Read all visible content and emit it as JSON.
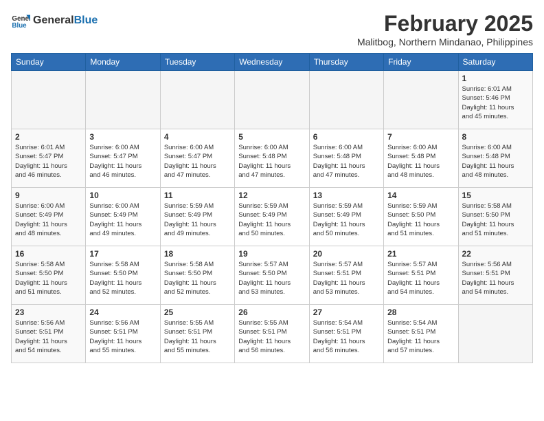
{
  "header": {
    "logo_general": "General",
    "logo_blue": "Blue",
    "month_year": "February 2025",
    "location": "Malitbog, Northern Mindanao, Philippines"
  },
  "days_of_week": [
    "Sunday",
    "Monday",
    "Tuesday",
    "Wednesday",
    "Thursday",
    "Friday",
    "Saturday"
  ],
  "weeks": [
    [
      {
        "day": "",
        "info": ""
      },
      {
        "day": "",
        "info": ""
      },
      {
        "day": "",
        "info": ""
      },
      {
        "day": "",
        "info": ""
      },
      {
        "day": "",
        "info": ""
      },
      {
        "day": "",
        "info": ""
      },
      {
        "day": "1",
        "info": "Sunrise: 6:01 AM\nSunset: 5:46 PM\nDaylight: 11 hours\nand 45 minutes."
      }
    ],
    [
      {
        "day": "2",
        "info": "Sunrise: 6:01 AM\nSunset: 5:47 PM\nDaylight: 11 hours\nand 46 minutes."
      },
      {
        "day": "3",
        "info": "Sunrise: 6:00 AM\nSunset: 5:47 PM\nDaylight: 11 hours\nand 46 minutes."
      },
      {
        "day": "4",
        "info": "Sunrise: 6:00 AM\nSunset: 5:47 PM\nDaylight: 11 hours\nand 47 minutes."
      },
      {
        "day": "5",
        "info": "Sunrise: 6:00 AM\nSunset: 5:48 PM\nDaylight: 11 hours\nand 47 minutes."
      },
      {
        "day": "6",
        "info": "Sunrise: 6:00 AM\nSunset: 5:48 PM\nDaylight: 11 hours\nand 47 minutes."
      },
      {
        "day": "7",
        "info": "Sunrise: 6:00 AM\nSunset: 5:48 PM\nDaylight: 11 hours\nand 48 minutes."
      },
      {
        "day": "8",
        "info": "Sunrise: 6:00 AM\nSunset: 5:48 PM\nDaylight: 11 hours\nand 48 minutes."
      }
    ],
    [
      {
        "day": "9",
        "info": "Sunrise: 6:00 AM\nSunset: 5:49 PM\nDaylight: 11 hours\nand 48 minutes."
      },
      {
        "day": "10",
        "info": "Sunrise: 6:00 AM\nSunset: 5:49 PM\nDaylight: 11 hours\nand 49 minutes."
      },
      {
        "day": "11",
        "info": "Sunrise: 5:59 AM\nSunset: 5:49 PM\nDaylight: 11 hours\nand 49 minutes."
      },
      {
        "day": "12",
        "info": "Sunrise: 5:59 AM\nSunset: 5:49 PM\nDaylight: 11 hours\nand 50 minutes."
      },
      {
        "day": "13",
        "info": "Sunrise: 5:59 AM\nSunset: 5:49 PM\nDaylight: 11 hours\nand 50 minutes."
      },
      {
        "day": "14",
        "info": "Sunrise: 5:59 AM\nSunset: 5:50 PM\nDaylight: 11 hours\nand 51 minutes."
      },
      {
        "day": "15",
        "info": "Sunrise: 5:58 AM\nSunset: 5:50 PM\nDaylight: 11 hours\nand 51 minutes."
      }
    ],
    [
      {
        "day": "16",
        "info": "Sunrise: 5:58 AM\nSunset: 5:50 PM\nDaylight: 11 hours\nand 51 minutes."
      },
      {
        "day": "17",
        "info": "Sunrise: 5:58 AM\nSunset: 5:50 PM\nDaylight: 11 hours\nand 52 minutes."
      },
      {
        "day": "18",
        "info": "Sunrise: 5:58 AM\nSunset: 5:50 PM\nDaylight: 11 hours\nand 52 minutes."
      },
      {
        "day": "19",
        "info": "Sunrise: 5:57 AM\nSunset: 5:50 PM\nDaylight: 11 hours\nand 53 minutes."
      },
      {
        "day": "20",
        "info": "Sunrise: 5:57 AM\nSunset: 5:51 PM\nDaylight: 11 hours\nand 53 minutes."
      },
      {
        "day": "21",
        "info": "Sunrise: 5:57 AM\nSunset: 5:51 PM\nDaylight: 11 hours\nand 54 minutes."
      },
      {
        "day": "22",
        "info": "Sunrise: 5:56 AM\nSunset: 5:51 PM\nDaylight: 11 hours\nand 54 minutes."
      }
    ],
    [
      {
        "day": "23",
        "info": "Sunrise: 5:56 AM\nSunset: 5:51 PM\nDaylight: 11 hours\nand 54 minutes."
      },
      {
        "day": "24",
        "info": "Sunrise: 5:56 AM\nSunset: 5:51 PM\nDaylight: 11 hours\nand 55 minutes."
      },
      {
        "day": "25",
        "info": "Sunrise: 5:55 AM\nSunset: 5:51 PM\nDaylight: 11 hours\nand 55 minutes."
      },
      {
        "day": "26",
        "info": "Sunrise: 5:55 AM\nSunset: 5:51 PM\nDaylight: 11 hours\nand 56 minutes."
      },
      {
        "day": "27",
        "info": "Sunrise: 5:54 AM\nSunset: 5:51 PM\nDaylight: 11 hours\nand 56 minutes."
      },
      {
        "day": "28",
        "info": "Sunrise: 5:54 AM\nSunset: 5:51 PM\nDaylight: 11 hours\nand 57 minutes."
      },
      {
        "day": "",
        "info": ""
      }
    ]
  ]
}
